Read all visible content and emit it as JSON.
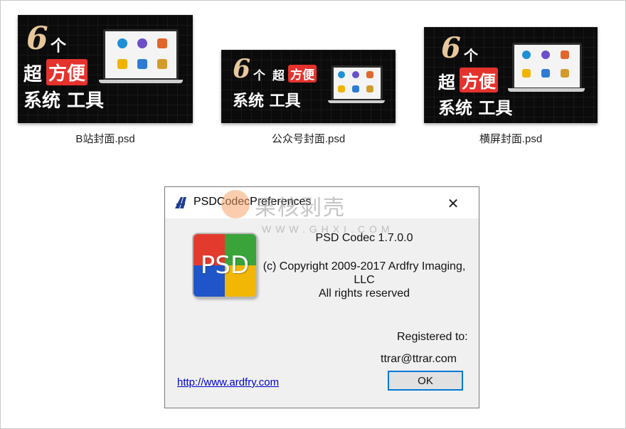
{
  "thumbnails": [
    {
      "caption": "B站封面.psd",
      "num": "6",
      "ge": "个",
      "chao": "超",
      "fang": "方便",
      "xt": "系统 工具"
    },
    {
      "caption": "公众号封面.psd",
      "num": "6",
      "ge": "个",
      "chao": "超",
      "fang": "方便",
      "xt": "系统 工具"
    },
    {
      "caption": "横屏封面.psd",
      "num": "6",
      "ge": "个",
      "chao": "超",
      "fang": "方便",
      "xt": "系统 工具"
    }
  ],
  "icons": [
    "gear-icon",
    "people-icon",
    "crab-icon",
    "monitor-icon",
    "doc-icon",
    "lock-icon"
  ],
  "colors": {
    "accent_red": "#e5322d",
    "gold": "#e8c79a",
    "button_border": "#0078d7",
    "link": "#0000cc"
  },
  "dialog": {
    "title": "PSDCodecPreferences",
    "minimize": "—",
    "close": "✕",
    "logo_text": "PSD",
    "version": "PSD Codec 1.7.0.0",
    "copyright_line1": "(c) Copyright 2009-2017 Ardfry Imaging,",
    "copyright_line2": "LLC",
    "rights": "All rights reserved",
    "registered_label": "Registered to:",
    "registered_value": "ttrar@ttrar.com",
    "link": "http://www.ardfry.com",
    "ok": "OK"
  },
  "watermark": {
    "text": "果核剥壳",
    "sub": "WWW.GHXI.COM"
  }
}
